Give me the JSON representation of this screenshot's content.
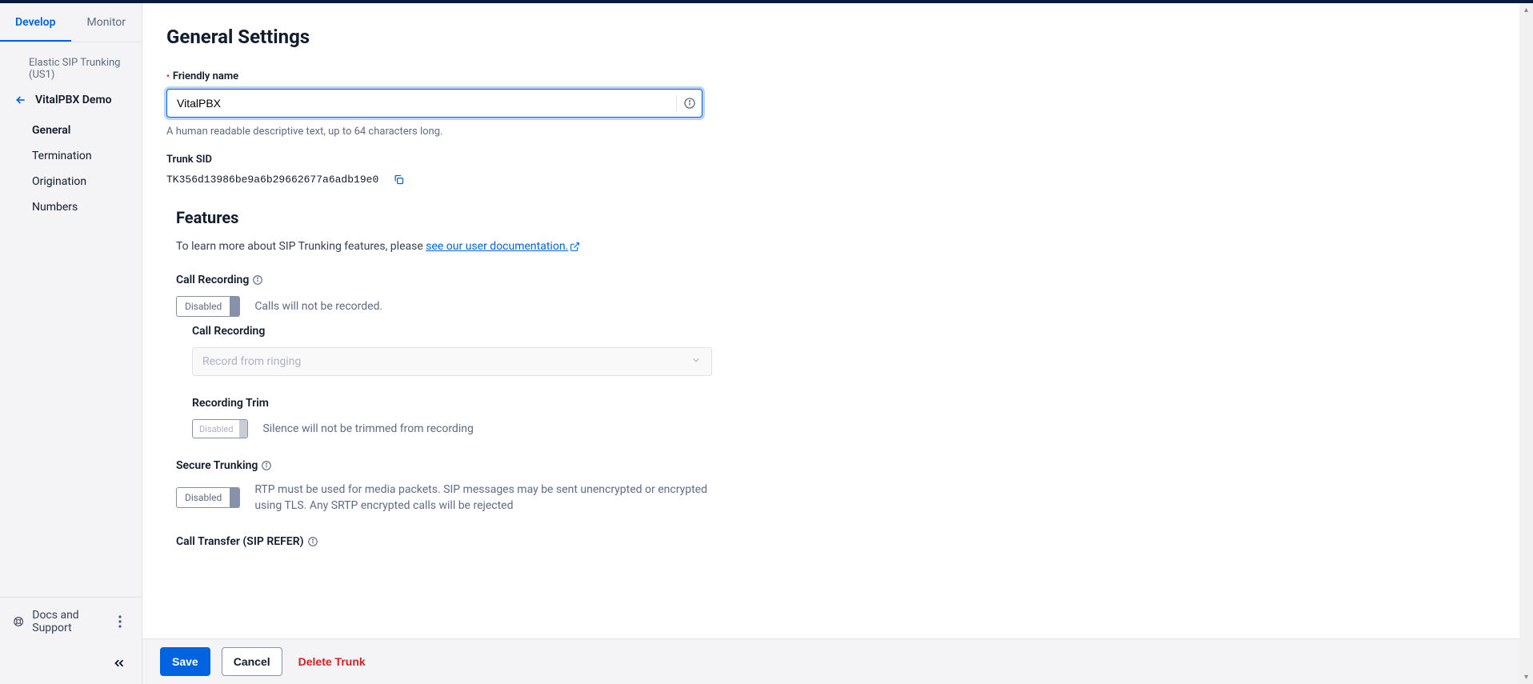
{
  "tabs": {
    "develop": "Develop",
    "monitor": "Monitor"
  },
  "sidebar": {
    "group": "Elastic SIP Trunking (US1)",
    "back_label": "VitalPBX Demo",
    "items": [
      "General",
      "Termination",
      "Origination",
      "Numbers"
    ],
    "docs": "Docs and Support"
  },
  "page": {
    "title": "General Settings",
    "friendly_name_label": "Friendly name",
    "friendly_name_value": "VitalPBX",
    "friendly_name_help": "A human readable descriptive text, up to 64 characters long.",
    "trunk_sid_label": "Trunk SID",
    "trunk_sid_value": "TK356d13986be9a6b29662677a6adb19e0"
  },
  "features": {
    "title": "Features",
    "learn_prefix": "To learn more about SIP Trunking features, please ",
    "learn_link": "see our user documentation.",
    "call_recording": {
      "label": "Call Recording",
      "toggle": "Disabled",
      "desc": "Calls will not be recorded.",
      "sub_label": "Call Recording",
      "select_value": "Record from ringing",
      "trim_label": "Recording Trim",
      "trim_toggle": "Disabled",
      "trim_desc": "Silence will not be trimmed from recording"
    },
    "secure_trunking": {
      "label": "Secure Trunking",
      "toggle": "Disabled",
      "desc": "RTP must be used for media packets. SIP messages may be sent unencrypted or encrypted using TLS. Any SRTP encrypted calls will be rejected"
    },
    "call_transfer": {
      "label": "Call Transfer (SIP REFER)"
    }
  },
  "actions": {
    "save": "Save",
    "cancel": "Cancel",
    "delete": "Delete Trunk"
  }
}
